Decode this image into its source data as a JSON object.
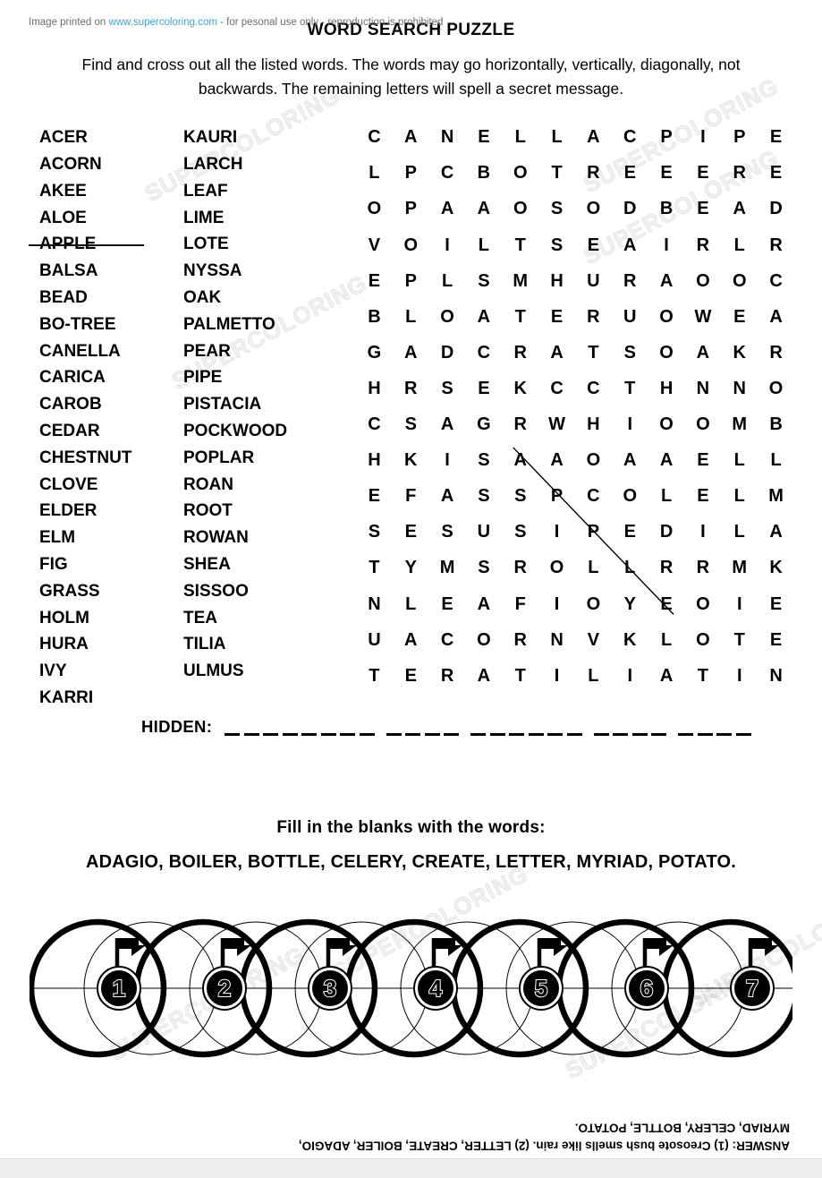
{
  "header": {
    "title": "WORD SEARCH PUZZLE",
    "instructions": "Find and cross out all the listed words. The words may go horizontally, vertically, diagonally, not backwards. The remaining letters will spell a secret message."
  },
  "word_list": {
    "column_1": [
      {
        "word": "ACER",
        "struck": false
      },
      {
        "word": "ACORN",
        "struck": false
      },
      {
        "word": "AKEE",
        "struck": false
      },
      {
        "word": "ALOE",
        "struck": false
      },
      {
        "word": "APPLE",
        "struck": true
      },
      {
        "word": "BALSA",
        "struck": false
      },
      {
        "word": "BEAD",
        "struck": false
      },
      {
        "word": "BO-TREE",
        "struck": false
      },
      {
        "word": "CANELLA",
        "struck": false
      },
      {
        "word": "CARICA",
        "struck": false
      },
      {
        "word": "CAROB",
        "struck": false
      },
      {
        "word": "CEDAR",
        "struck": false
      },
      {
        "word": "CHESTNUT",
        "struck": false
      },
      {
        "word": "CLOVE",
        "struck": false
      },
      {
        "word": "ELDER",
        "struck": false
      },
      {
        "word": "ELM",
        "struck": false
      },
      {
        "word": "FIG",
        "struck": false
      },
      {
        "word": "GRASS",
        "struck": false
      },
      {
        "word": "HOLM",
        "struck": false
      },
      {
        "word": "HURA",
        "struck": false
      },
      {
        "word": "IVY",
        "struck": false
      },
      {
        "word": "KARRI",
        "struck": false
      }
    ],
    "column_2": [
      {
        "word": "KAURI",
        "struck": false
      },
      {
        "word": "LARCH",
        "struck": false
      },
      {
        "word": "LEAF",
        "struck": false
      },
      {
        "word": "LIME",
        "struck": false
      },
      {
        "word": "LOTE",
        "struck": false
      },
      {
        "word": "NYSSA",
        "struck": false
      },
      {
        "word": "OAK",
        "struck": false
      },
      {
        "word": "PALMETTO",
        "struck": false
      },
      {
        "word": "PEAR",
        "struck": false
      },
      {
        "word": "PIPE",
        "struck": false
      },
      {
        "word": "PISTACIA",
        "struck": false
      },
      {
        "word": "POCKWOOD",
        "struck": false
      },
      {
        "word": "POPLAR",
        "struck": false
      },
      {
        "word": "ROAN",
        "struck": false
      },
      {
        "word": "ROOT",
        "struck": false
      },
      {
        "word": "ROWAN",
        "struck": false
      },
      {
        "word": "SHEA",
        "struck": false
      },
      {
        "word": "SISSOO",
        "struck": false
      },
      {
        "word": "TEA",
        "struck": false
      },
      {
        "word": "TILIA",
        "struck": false
      },
      {
        "word": "ULMUS",
        "struck": false
      }
    ]
  },
  "grid": {
    "rows": 16,
    "cols": 12,
    "letters": [
      [
        "C",
        "A",
        "N",
        "E",
        "L",
        "L",
        "A",
        "C",
        "P",
        "I",
        "P",
        "E"
      ],
      [
        "L",
        "P",
        "C",
        "B",
        "O",
        "T",
        "R",
        "E",
        "E",
        "E",
        "R",
        "E"
      ],
      [
        "O",
        "P",
        "A",
        "A",
        "O",
        "S",
        "O",
        "D",
        "B",
        "E",
        "A",
        "D"
      ],
      [
        "V",
        "O",
        "I",
        "L",
        "T",
        "S",
        "E",
        "A",
        "I",
        "R",
        "L",
        "R"
      ],
      [
        "E",
        "P",
        "L",
        "S",
        "M",
        "H",
        "U",
        "R",
        "A",
        "O",
        "O",
        "C"
      ],
      [
        "B",
        "L",
        "O",
        "A",
        "T",
        "E",
        "R",
        "U",
        "O",
        "W",
        "E",
        "A"
      ],
      [
        "G",
        "A",
        "D",
        "C",
        "R",
        "A",
        "T",
        "S",
        "O",
        "A",
        "K",
        "R"
      ],
      [
        "H",
        "R",
        "S",
        "E",
        "K",
        "C",
        "C",
        "T",
        "H",
        "N",
        "N",
        "O"
      ],
      [
        "C",
        "S",
        "A",
        "G",
        "R",
        "W",
        "H",
        "I",
        "O",
        "O",
        "M",
        "B"
      ],
      [
        "H",
        "K",
        "I",
        "S",
        "A",
        "A",
        "O",
        "A",
        "A",
        "E",
        "L",
        "L"
      ],
      [
        "E",
        "F",
        "A",
        "S",
        "S",
        "P",
        "C",
        "O",
        "L",
        "E",
        "L",
        "M"
      ],
      [
        "S",
        "E",
        "S",
        "U",
        "S",
        "I",
        "P",
        "E",
        "D",
        "I",
        "L",
        "A"
      ],
      [
        "T",
        "Y",
        "M",
        "S",
        "R",
        "O",
        "L",
        "L",
        "R",
        "R",
        "M",
        "K"
      ],
      [
        "N",
        "L",
        "E",
        "A",
        "F",
        "I",
        "O",
        "Y",
        "E",
        "O",
        "I",
        "E"
      ],
      [
        "U",
        "A",
        "C",
        "O",
        "R",
        "N",
        "V",
        "K",
        "L",
        "O",
        "T",
        "E"
      ],
      [
        "T",
        "E",
        "R",
        "A",
        "T",
        "I",
        "L",
        "I",
        "A",
        "T",
        "I",
        "N"
      ]
    ],
    "strikes": [
      {
        "word": "APPLE",
        "from_row": 9,
        "from_col": 4,
        "to_row": 13,
        "to_col": 8
      }
    ]
  },
  "hidden": {
    "label": "HIDDEN:",
    "blank_groups": [
      8,
      4,
      6,
      4,
      4
    ]
  },
  "fill_in": {
    "prompt": "Fill in the blanks with the words:",
    "words": "ADAGIO, BOILER, BOTTLE, CELERY, CREATE, LETTER, MYRIAD, POTATO."
  },
  "circles": {
    "count": 7,
    "labels": [
      "1",
      "2",
      "3",
      "4",
      "5",
      "6",
      "7"
    ],
    "marker_icon": "flag-icon"
  },
  "answer": {
    "line_1": "ANSWER: (1) Creosote bush smells like rain. (2) LETTER, CREATE, BOILER, ADAGIO,",
    "line_2": "MYRIAD, CELERY, BOTTLE, POTATO."
  },
  "footer": {
    "prefix": "Image printed on ",
    "brand": "www.supercoloring.com",
    "suffix": " - for pesonal use only - reproduction is prohibited"
  },
  "watermark": {
    "text": "SUPERCOLORING"
  },
  "colors": {
    "ink": "#000000",
    "paper": "#ffffff",
    "footer_bg": "#efefef",
    "footer_text": "#6d6d6d",
    "footer_link": "#3aa8d8",
    "watermark": "rgba(0,0,0,0.06)"
  }
}
